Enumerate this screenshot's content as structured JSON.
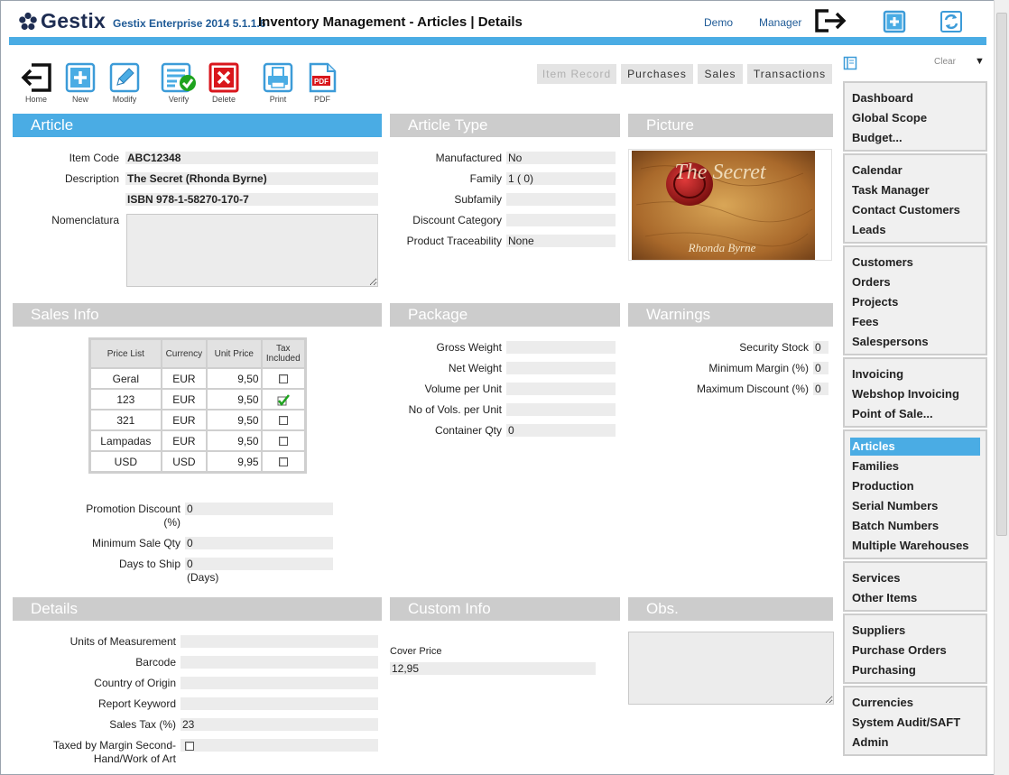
{
  "header": {
    "logo_text": "Gestix",
    "app_version": "Gestix Enterprise 2014 5.1.1.6",
    "page_title": "Inventory Management - Articles | Details",
    "user_company": "Demo",
    "user_role": "Manager"
  },
  "toolbar": {
    "home": "Home",
    "new": "New",
    "modify": "Modify",
    "verify": "Verify",
    "delete": "Delete",
    "print": "Print",
    "pdf": "PDF",
    "pdf_badge": "PDF"
  },
  "tabs": [
    "Item Record",
    "Purchases",
    "Sales",
    "Transactions"
  ],
  "sections": {
    "article": "Article",
    "article_type": "Article Type",
    "picture": "Picture",
    "sales_info": "Sales Info",
    "package": "Package",
    "warnings": "Warnings",
    "details": "Details",
    "custom_info": "Custom Info",
    "obs": "Obs."
  },
  "article": {
    "item_code_label": "Item Code",
    "item_code": "ABC12348",
    "description_label": "Description",
    "description": "The Secret (Rhonda Byrne)",
    "description2": "ISBN 978-1-58270-170-7",
    "nomenclatura_label": "Nomenclatura",
    "nomenclatura": ""
  },
  "article_type": {
    "manufactured_label": "Manufactured",
    "manufactured": "No",
    "family_label": "Family",
    "family": "1 ( 0)",
    "subfamily_label": "Subfamily",
    "subfamily": "",
    "discount_category_label": "Discount Category",
    "discount_category": "",
    "traceability_label": "Product Traceability",
    "traceability": "None"
  },
  "picture": {
    "cover_title": "The Secret",
    "cover_author": "Rhonda Byrne"
  },
  "sales_info": {
    "columns": [
      "Price List",
      "Currency",
      "Unit Price",
      "Tax Included"
    ],
    "rows": [
      {
        "price_list": "Geral",
        "currency": "EUR",
        "unit_price": "9,50",
        "tax_included": false
      },
      {
        "price_list": "123",
        "currency": "EUR",
        "unit_price": "9,50",
        "tax_included": true
      },
      {
        "price_list": "321",
        "currency": "EUR",
        "unit_price": "9,50",
        "tax_included": false
      },
      {
        "price_list": "Lampadas",
        "currency": "EUR",
        "unit_price": "9,50",
        "tax_included": false
      },
      {
        "price_list": "USD",
        "currency": "USD",
        "unit_price": "9,95",
        "tax_included": false
      }
    ],
    "promotion_discount_label_1": "Promotion Discount",
    "promotion_discount_label_2": "(%)",
    "promotion_discount": "0",
    "min_sale_qty_label": "Minimum Sale Qty",
    "min_sale_qty": "0",
    "days_to_ship_label": "Days to Ship",
    "days_to_ship": "0",
    "days_unit": "(Days)"
  },
  "package": {
    "gross_weight_label": "Gross Weight",
    "gross_weight": "",
    "net_weight_label": "Net Weight",
    "net_weight": "",
    "volume_label": "Volume per Unit",
    "volume": "",
    "vols_label": "No of Vols. per Unit",
    "vols": "",
    "container_label": "Container Qty",
    "container": "0"
  },
  "warnings": {
    "security_stock_label": "Security Stock",
    "security_stock": "0",
    "min_margin_label": "Minimum Margin (%)",
    "min_margin": "0",
    "max_discount_label": "Maximum Discount (%)",
    "max_discount": "0"
  },
  "details": {
    "units_label": "Units of Measurement",
    "units": "",
    "barcode_label": "Barcode",
    "barcode": "",
    "country_label": "Country of Origin",
    "country": "",
    "keyword_label": "Report Keyword",
    "keyword": "",
    "sales_tax_label": "Sales Tax (%)",
    "sales_tax": "23",
    "taxed_margin_label_1": "Taxed by Margin Second-",
    "taxed_margin_label_2": "Hand/Work of Art"
  },
  "custom_info": {
    "cover_price_label": "Cover Price",
    "cover_price": "12,95"
  },
  "sidebar": {
    "clear_label": "Clear",
    "groups": [
      [
        "Dashboard",
        "Global Scope",
        "Budget..."
      ],
      [
        "Calendar",
        "Task Manager",
        "Contact Customers",
        "Leads"
      ],
      [
        "Customers",
        "Orders",
        "Projects",
        "Fees",
        "Salespersons"
      ],
      [
        "Invoicing",
        "Webshop Invoicing",
        "Point of Sale..."
      ],
      [
        "Articles",
        "Families",
        "Production",
        "Serial Numbers",
        "Batch Numbers",
        "Multiple Warehouses"
      ],
      [
        "Services",
        "Other Items"
      ],
      [
        "Suppliers",
        "Purchase Orders",
        "Purchasing"
      ],
      [
        "Currencies",
        "System Audit/SAFT",
        "Admin"
      ]
    ],
    "selected": "Articles"
  },
  "colors": {
    "accent": "#4aace4",
    "section_inactive": "#cccccc",
    "field_bg": "#ececec",
    "brand_text": "#1e2d52",
    "delete_red": "#d9161c",
    "verify_green": "#1ea31e"
  }
}
